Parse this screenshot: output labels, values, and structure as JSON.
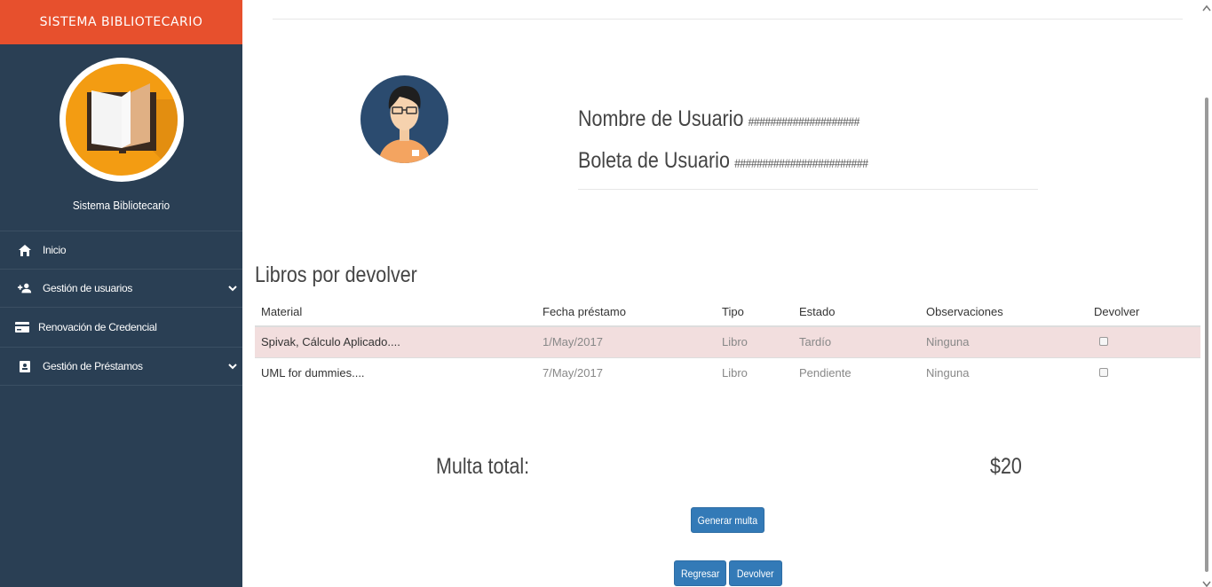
{
  "app": {
    "brand": "SISTEMA BIBLIOTECARIO",
    "system_name": "Sistema Bibliotecario"
  },
  "sidebar": {
    "items": [
      {
        "label": "Inicio",
        "icon": "home-icon"
      },
      {
        "label": "Gestión de usuarios",
        "icon": "add-user-icon",
        "expandable": true
      },
      {
        "label": "Renovación de Credencial",
        "icon": "credit-card-icon"
      },
      {
        "label": "Gestión de Préstamos",
        "icon": "book-badge-icon",
        "expandable": true
      }
    ]
  },
  "user": {
    "name_label": "Nombre de Usuario",
    "name_value": "####################",
    "boleta_label": "Boleta de Usuario",
    "boleta_value": "########################"
  },
  "loans": {
    "title": "Libros por devolver",
    "columns": [
      "Material",
      "Fecha préstamo",
      "Tipo",
      "Estado",
      "Observaciones",
      "Devolver"
    ],
    "rows": [
      {
        "material": "Spivak, Cálculo Aplicado....",
        "fecha": "1/May/2017",
        "tipo": "Libro",
        "estado": "Tardío",
        "observaciones": "Ninguna",
        "devolver": false
      },
      {
        "material": "UML for dummies....",
        "fecha": "7/May/2017",
        "tipo": "Libro",
        "estado": "Pendiente",
        "observaciones": "Ninguna",
        "devolver": false
      }
    ]
  },
  "fine": {
    "label": "Multa total:",
    "value": "$20"
  },
  "buttons": {
    "generate": "Generar multa",
    "back": "Regresar",
    "return": "Devolver"
  },
  "colors": {
    "brand": "#e7502d",
    "sidebar": "#2a3f54",
    "primary": "#337ab7",
    "danger_row": "#f2dede",
    "logo": "#f39c12"
  }
}
